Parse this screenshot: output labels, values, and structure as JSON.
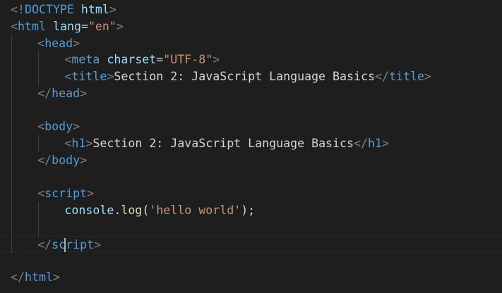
{
  "editor": {
    "language": "html",
    "indent_unit": "    ",
    "cursor": {
      "line": 14,
      "column": 9
    },
    "colors": {
      "background": "#1e1e1e",
      "punctuation": "#808080",
      "tag": "#569cd6",
      "attribute": "#9cdcfe",
      "string": "#ce9178",
      "text": "#d4d4d4",
      "function": "#dcdcaa",
      "variable": "#9cdcfe",
      "indent_guide": "#404040",
      "current_line_border": "#282828",
      "caret": "#aeafad"
    },
    "lines": [
      {
        "indent": 0,
        "tokens": [
          {
            "t": "<!",
            "k": "punct"
          },
          {
            "t": "DOCTYPE",
            "k": "tag"
          },
          {
            "t": " ",
            "k": "text"
          },
          {
            "t": "html",
            "k": "attr"
          },
          {
            "t": ">",
            "k": "punct"
          }
        ]
      },
      {
        "indent": 0,
        "tokens": [
          {
            "t": "<",
            "k": "punct"
          },
          {
            "t": "html",
            "k": "tag"
          },
          {
            "t": " ",
            "k": "text"
          },
          {
            "t": "lang",
            "k": "attr"
          },
          {
            "t": "=",
            "k": "text"
          },
          {
            "t": "\"en\"",
            "k": "str"
          },
          {
            "t": ">",
            "k": "punct"
          }
        ]
      },
      {
        "indent": 1,
        "tokens": [
          {
            "t": "<",
            "k": "punct"
          },
          {
            "t": "head",
            "k": "tag"
          },
          {
            "t": ">",
            "k": "punct"
          }
        ]
      },
      {
        "indent": 2,
        "tokens": [
          {
            "t": "<",
            "k": "punct"
          },
          {
            "t": "meta",
            "k": "tag"
          },
          {
            "t": " ",
            "k": "text"
          },
          {
            "t": "charset",
            "k": "attr"
          },
          {
            "t": "=",
            "k": "text"
          },
          {
            "t": "\"UTF-8\"",
            "k": "str"
          },
          {
            "t": ">",
            "k": "punct"
          }
        ]
      },
      {
        "indent": 2,
        "tokens": [
          {
            "t": "<",
            "k": "punct"
          },
          {
            "t": "title",
            "k": "tag"
          },
          {
            "t": ">",
            "k": "punct"
          },
          {
            "t": "Section 2: JavaScript Language Basics",
            "k": "text"
          },
          {
            "t": "</",
            "k": "punct"
          },
          {
            "t": "title",
            "k": "tag"
          },
          {
            "t": ">",
            "k": "punct"
          }
        ]
      },
      {
        "indent": 1,
        "tokens": [
          {
            "t": "</",
            "k": "punct"
          },
          {
            "t": "head",
            "k": "tag"
          },
          {
            "t": ">",
            "k": "punct"
          }
        ]
      },
      {
        "indent": 1,
        "tokens": []
      },
      {
        "indent": 1,
        "tokens": [
          {
            "t": "<",
            "k": "punct"
          },
          {
            "t": "body",
            "k": "tag"
          },
          {
            "t": ">",
            "k": "punct"
          }
        ]
      },
      {
        "indent": 2,
        "tokens": [
          {
            "t": "<",
            "k": "punct"
          },
          {
            "t": "h1",
            "k": "tag"
          },
          {
            "t": ">",
            "k": "punct"
          },
          {
            "t": "Section 2: JavaScript Language Basics",
            "k": "text"
          },
          {
            "t": "</",
            "k": "punct"
          },
          {
            "t": "h1",
            "k": "tag"
          },
          {
            "t": ">",
            "k": "punct"
          }
        ]
      },
      {
        "indent": 1,
        "tokens": [
          {
            "t": "</",
            "k": "punct"
          },
          {
            "t": "body",
            "k": "tag"
          },
          {
            "t": ">",
            "k": "punct"
          }
        ]
      },
      {
        "indent": 1,
        "tokens": []
      },
      {
        "indent": 1,
        "tokens": [
          {
            "t": "<",
            "k": "punct"
          },
          {
            "t": "script",
            "k": "tag"
          },
          {
            "t": ">",
            "k": "punct"
          }
        ]
      },
      {
        "indent": 2,
        "tokens": [
          {
            "t": "console",
            "k": "var"
          },
          {
            "t": ".",
            "k": "text"
          },
          {
            "t": "log",
            "k": "fn"
          },
          {
            "t": "(",
            "k": "text"
          },
          {
            "t": "'hello world'",
            "k": "str"
          },
          {
            "t": ");",
            "k": "text"
          }
        ]
      },
      {
        "indent": 2,
        "tokens": []
      },
      {
        "indent": 1,
        "tokens": [
          {
            "t": "</",
            "k": "punct"
          },
          {
            "t": "script",
            "k": "tag"
          },
          {
            "t": ">",
            "k": "punct"
          }
        ]
      },
      {
        "indent": 0,
        "tokens": []
      },
      {
        "indent": 0,
        "tokens": [
          {
            "t": "</",
            "k": "punct"
          },
          {
            "t": "html",
            "k": "tag"
          },
          {
            "t": ">",
            "k": "punct"
          }
        ]
      }
    ]
  }
}
